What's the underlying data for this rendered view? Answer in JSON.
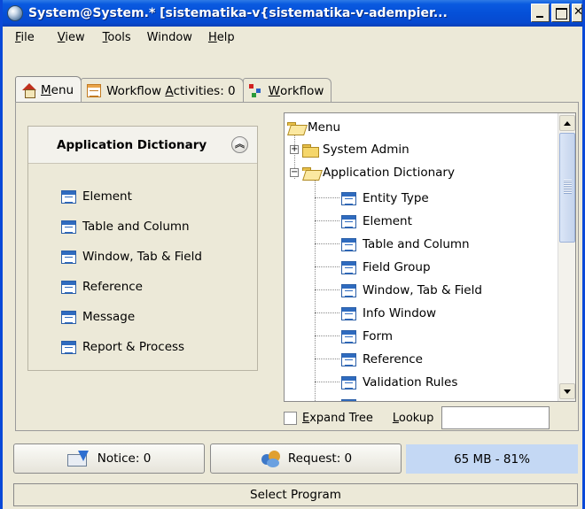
{
  "window": {
    "title": "System@System.* [sistematika-v{sistematika-v-adempier..."
  },
  "menubar": {
    "items": [
      {
        "label": "File",
        "mnemonic": "F",
        "rest": "ile"
      },
      {
        "label": "View",
        "mnemonic": "V",
        "rest": "iew"
      },
      {
        "label": "Tools",
        "mnemonic": "T",
        "rest": "ools"
      },
      {
        "label": "Window",
        "mnemonic": "",
        "rest": "Window"
      },
      {
        "label": "Help",
        "mnemonic": "H",
        "rest": "elp"
      }
    ]
  },
  "tabs": [
    {
      "label": "Menu",
      "mnemonic": "M",
      "rest": "enu",
      "icon": "home-icon",
      "active": true
    },
    {
      "label": "Workflow Activities: 0",
      "pre": "Workflow ",
      "mnemonic": "A",
      "rest": "ctivities: 0",
      "icon": "workflow-activities-icon"
    },
    {
      "label": "Workflow",
      "mnemonic": "W",
      "rest": "orkflow",
      "icon": "workflow-icon"
    }
  ],
  "taskpane": {
    "title": "Application Dictionary",
    "items": [
      {
        "label": "Element"
      },
      {
        "label": "Table and Column"
      },
      {
        "label": "Window, Tab & Field"
      },
      {
        "label": "Reference"
      },
      {
        "label": "Message"
      },
      {
        "label": "Report & Process"
      }
    ]
  },
  "tree": {
    "root": "Menu",
    "nodes": [
      {
        "label": "System Admin",
        "type": "folder",
        "expanded": false
      },
      {
        "label": "Application Dictionary",
        "type": "folder",
        "expanded": true
      }
    ],
    "children": [
      {
        "label": "Entity Type"
      },
      {
        "label": "Element"
      },
      {
        "label": "Table and Column"
      },
      {
        "label": "Field Group"
      },
      {
        "label": "Window, Tab & Field"
      },
      {
        "label": "Info Window"
      },
      {
        "label": "Form"
      },
      {
        "label": "Reference"
      },
      {
        "label": "Validation Rules"
      }
    ]
  },
  "tree_footer": {
    "expand_label": "Expand Tree",
    "expand_mnemonic": "E",
    "expand_rest": "xpand Tree",
    "lookup_label": "Lookup",
    "lookup_mnemonic": "L",
    "lookup_rest": "ookup",
    "lookup_value": ""
  },
  "bottom": {
    "notice": "Notice: 0",
    "request": "Request: 0",
    "memory": "65 MB - 81%"
  },
  "status": {
    "text": "Select Program"
  },
  "colors": {
    "titlebar": "#0550d8",
    "memory_bg": "#c4d8f4",
    "window_bg": "#ece9d8"
  }
}
